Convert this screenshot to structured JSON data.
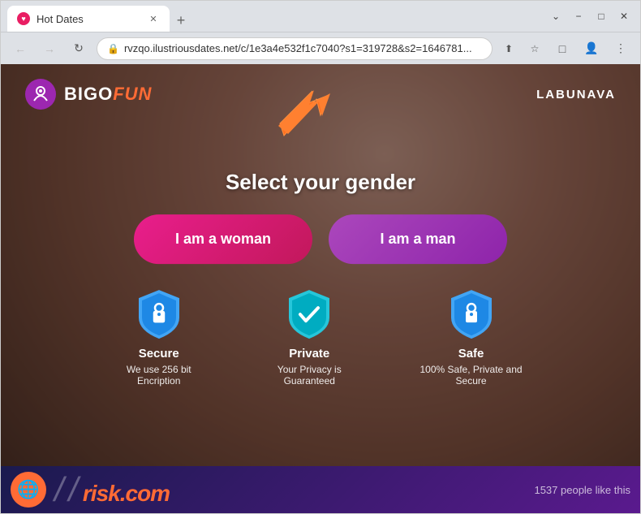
{
  "browser": {
    "tab_title": "Hot Dates",
    "tab_favicon": "♥",
    "url": "rvzqo.ilustriousdates.net/c/1e3a4e532f1c7040?s1=319728&s2=1646781...",
    "new_tab_label": "+",
    "minimize_label": "−",
    "maximize_label": "□",
    "close_label": "✕",
    "nav_back": "←",
    "nav_forward": "→",
    "nav_refresh": "↻"
  },
  "site": {
    "logo_bigo": "BIGO",
    "logo_fun": "FUN",
    "logo_icon": "◎",
    "nav_right": "LABUNAVA"
  },
  "page": {
    "select_gender_title": "Select your gender",
    "btn_woman_label": "I am a woman",
    "btn_man_label": "I am a man"
  },
  "trust": {
    "secure_title": "Secure",
    "secure_desc": "We use 256 bit Encription",
    "private_title": "Private",
    "private_desc": "Your Privacy is Guaranteed",
    "safe_title": "Safe",
    "safe_desc": "100% Safe, Private and Secure"
  },
  "bottom_bar": {
    "like_count": "1537 people like this",
    "logo": "risk.com"
  },
  "colors": {
    "accent_orange": "#ff6b35",
    "btn_woman": "#e91e8c",
    "btn_man": "#ab47bc",
    "logo_purple": "#9c27b0",
    "shield_blue": "#42a5f5",
    "shield_teal": "#26c6da"
  }
}
